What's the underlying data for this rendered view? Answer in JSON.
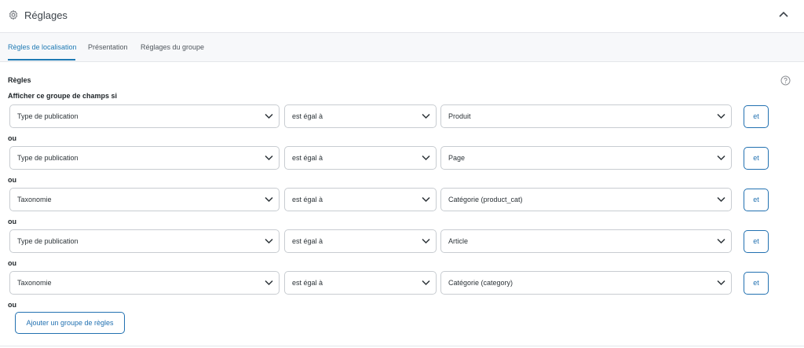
{
  "header": {
    "title": "Réglages",
    "icon": "gear-icon"
  },
  "tabs": [
    {
      "label": "Règles de localisation",
      "active": true
    },
    {
      "label": "Présentation",
      "active": false
    },
    {
      "label": "Réglages du groupe",
      "active": false
    }
  ],
  "rules": {
    "heading": "Règles",
    "subheading": "Afficher ce groupe de champs si",
    "or_label": "ou",
    "and_label": "et",
    "groups": [
      {
        "param": "Type de publication",
        "operator": "est égal à",
        "value": "Produit"
      },
      {
        "param": "Type de publication",
        "operator": "est égal à",
        "value": "Page"
      },
      {
        "param": "Taxonomie",
        "operator": "est égal à",
        "value": "Catégorie (product_cat)"
      },
      {
        "param": "Type de publication",
        "operator": "est égal à",
        "value": "Article"
      },
      {
        "param": "Taxonomie",
        "operator": "est égal à",
        "value": "Catégorie (category)"
      }
    ],
    "add_group_label": "Ajouter un groupe de règles"
  },
  "colors": {
    "accent": "#2271b1",
    "border": "#c8ccd1",
    "tab_bg": "#f7f8fa"
  }
}
